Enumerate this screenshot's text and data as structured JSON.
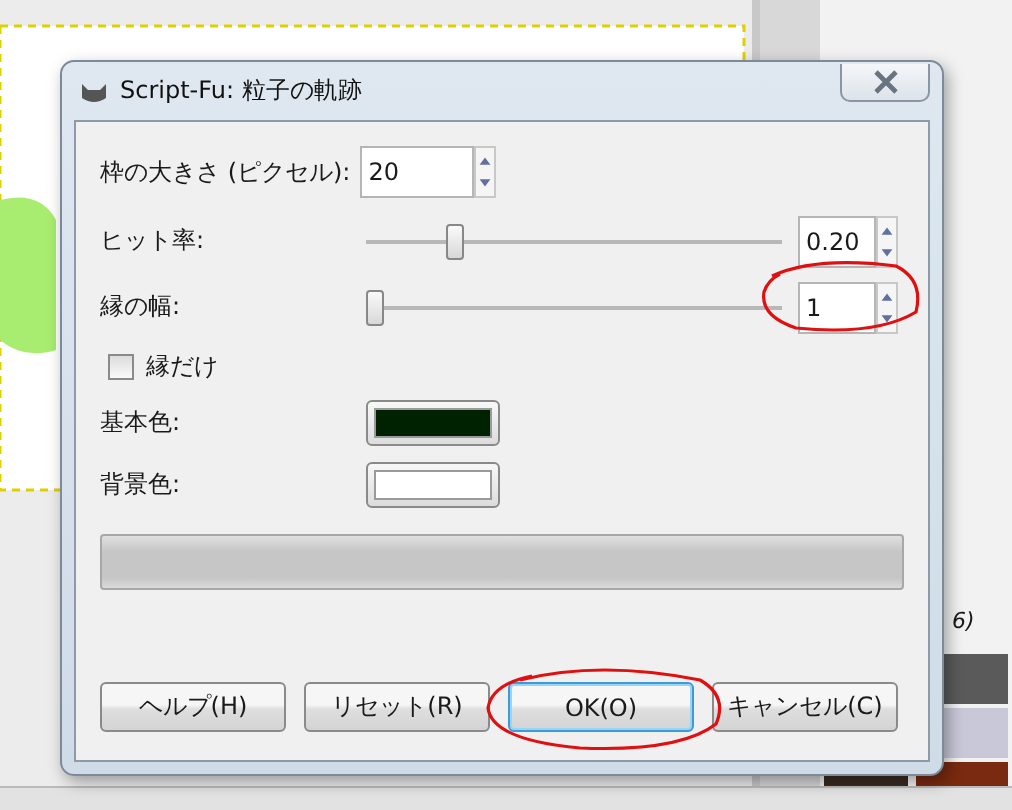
{
  "window": {
    "title": "Script-Fu: 粒子の軌跡"
  },
  "fields": [
    {
      "kind": "spin",
      "label": "枠の大きさ (ピクセル):",
      "value": "20"
    },
    {
      "kind": "slider",
      "label": "ヒット率:",
      "level": 0.2,
      "value": "0.20"
    },
    {
      "kind": "slider",
      "label": "縁の幅:",
      "level": 0,
      "value": "1"
    },
    {
      "kind": "checkbox",
      "label": "縁だけ",
      "checked": false
    },
    {
      "kind": "color",
      "label": "基本色:",
      "color": "#002200"
    },
    {
      "kind": "color",
      "label": "背景色:",
      "color": "#ffffff"
    }
  ],
  "progress_bar": {
    "level": 0
  },
  "buttons": [
    {
      "label": "ヘルプ(H)",
      "focused": false
    },
    {
      "label": "リセット(R)",
      "focused": false
    },
    {
      "label": "OK(O)",
      "focused": true
    },
    {
      "label": "キャンセル(C)",
      "focused": false
    }
  ],
  "side_panel": {
    "text": "6)"
  }
}
